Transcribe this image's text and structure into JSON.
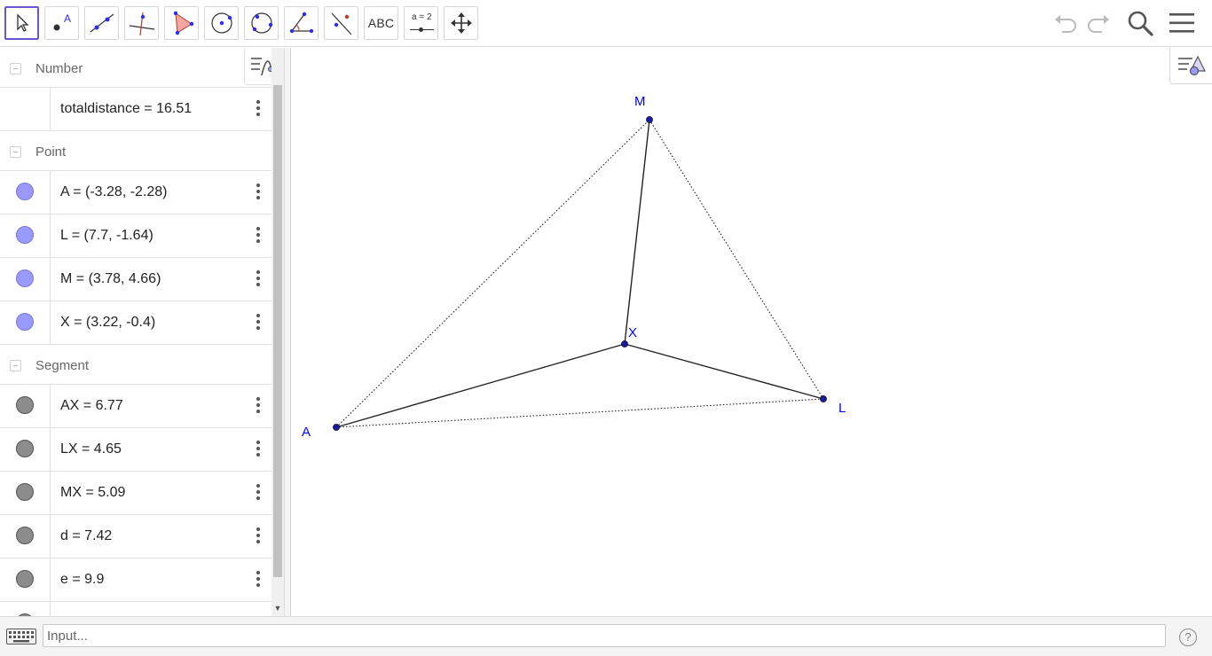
{
  "toolbar": {
    "tools": [
      {
        "name": "move-tool",
        "icon": "cursor-arrow-icon"
      },
      {
        "name": "point-tool",
        "icon": "point-icon",
        "label": "A"
      },
      {
        "name": "line-tool",
        "icon": "line-icon"
      },
      {
        "name": "perpendicular-line-tool",
        "icon": "perpendicular-line-icon"
      },
      {
        "name": "polygon-tool",
        "icon": "polygon-icon"
      },
      {
        "name": "circle-center-point-tool",
        "icon": "circle-center-point-icon"
      },
      {
        "name": "circle-three-points-tool",
        "icon": "circle-three-points-icon"
      },
      {
        "name": "angle-tool",
        "icon": "angle-icon"
      },
      {
        "name": "reflect-tool",
        "icon": "reflect-about-line-icon"
      },
      {
        "name": "text-tool",
        "icon": "text-icon",
        "label": "ABC"
      },
      {
        "name": "slider-tool",
        "icon": "slider-icon",
        "label": "a = 2"
      },
      {
        "name": "move-graphics-view-tool",
        "icon": "move-arrows-icon"
      }
    ],
    "right": [
      "undo-icon",
      "redo-icon",
      "search-icon",
      "hamburger-menu-icon"
    ]
  },
  "algebra": {
    "groups": [
      {
        "title": "Number",
        "items": [
          {
            "expr": "totaldistance = 16.51",
            "kind": "number"
          }
        ]
      },
      {
        "title": "Point",
        "items": [
          {
            "expr": "A = (-3.28, -2.28)",
            "kind": "point"
          },
          {
            "expr": "L = (7.7, -1.64)",
            "kind": "point"
          },
          {
            "expr": "M = (3.78, 4.66)",
            "kind": "point"
          },
          {
            "expr": "X = (3.22, -0.4)",
            "kind": "point"
          }
        ]
      },
      {
        "title": "Segment",
        "items": [
          {
            "expr": "AX = 6.77",
            "kind": "segment"
          },
          {
            "expr": "LX = 4.65",
            "kind": "segment"
          },
          {
            "expr": "MX = 5.09",
            "kind": "segment"
          },
          {
            "expr": "d = 7.42",
            "kind": "segment"
          },
          {
            "expr": "e = 9.9",
            "kind": "segment"
          }
        ]
      }
    ]
  },
  "graphics": {
    "points": [
      {
        "label": "A",
        "x": -3.28,
        "y": -2.28
      },
      {
        "label": "L",
        "x": 7.7,
        "y": -1.64
      },
      {
        "label": "M",
        "x": 3.78,
        "y": 4.66
      },
      {
        "label": "X",
        "x": 3.22,
        "y": -0.4
      }
    ],
    "solid_segments": [
      [
        "A",
        "X"
      ],
      [
        "L",
        "X"
      ],
      [
        "M",
        "X"
      ]
    ],
    "dotted_segments": [
      [
        "A",
        "M"
      ],
      [
        "M",
        "L"
      ],
      [
        "A",
        "L"
      ]
    ],
    "point_color": "#1a1aa6",
    "label_color": "#0000ff"
  },
  "input": {
    "placeholder": "Input..."
  },
  "colors": {
    "accent": "#6557d2",
    "point_marble": "#9999ff",
    "segment_marble": "#8c8c8c"
  }
}
